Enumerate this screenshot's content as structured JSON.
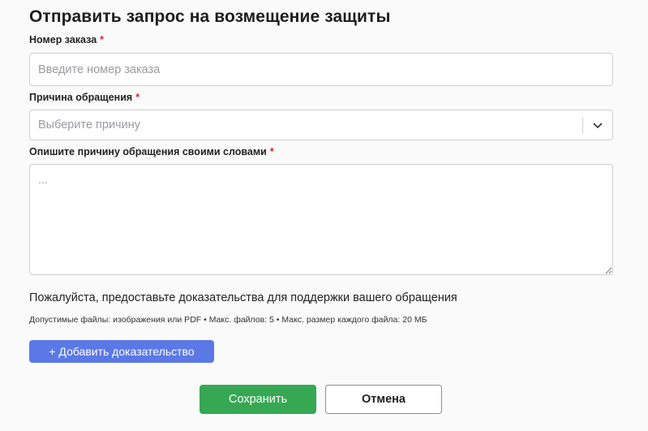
{
  "form": {
    "title": "Отправить запрос на возмещение защиты",
    "required_mark": "*",
    "order_number": {
      "label": "Номер заказа",
      "placeholder": "Введите номер заказа",
      "value": ""
    },
    "reason": {
      "label": "Причина обращения",
      "placeholder": "Выберите причину",
      "arrow_icon": "chevron-down-icon"
    },
    "description": {
      "label": "Опишите причину обращения своими словами",
      "placeholder": "...",
      "value": ""
    },
    "evidence": {
      "text": "Пожалуйста, предоставьте доказательства для поддержки вашего обращения",
      "hint": "Допустимые файлы: изображения или PDF • Макс. файлов: 5 • Макс. размер каждого файла: 20 МБ",
      "add_label": "+ Добавить доказательство"
    },
    "actions": {
      "save_label": "Сохранить",
      "cancel_label": "Отмена"
    }
  },
  "colors": {
    "required": "#e0242b",
    "add_button": "#5a78e6",
    "save_button": "#36a854",
    "input_border": "#cfcfd4",
    "placeholder": "#9a9aa0"
  }
}
